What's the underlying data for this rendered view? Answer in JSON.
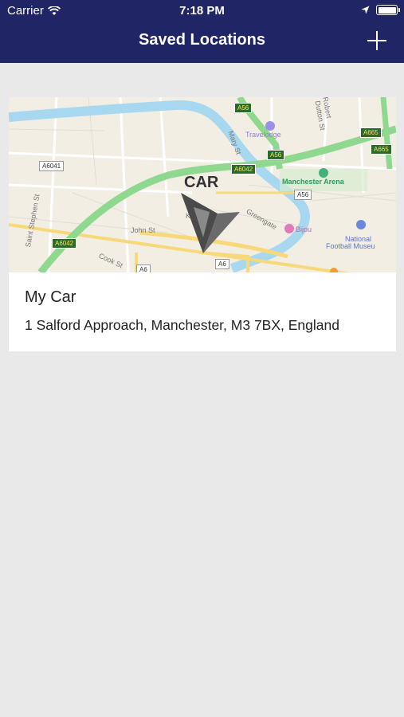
{
  "status": {
    "carrier": "Carrier",
    "time": "7:18 PM"
  },
  "nav": {
    "title": "Saved Locations",
    "add_icon": "plus-icon"
  },
  "location": {
    "name": "My Car",
    "address": "1 Salford Approach, Manchester, M3 7BX, England",
    "marker_label": "CAR",
    "map_labels": {
      "travelodge": "Travelodge",
      "manchester_arena": "Manchester Arena",
      "bijou": "Bijou",
      "national_football_museum_1": "National",
      "national_football_museum_2": "Football Museu",
      "john_st": "John St",
      "mary_st": "Mary St",
      "saint_stephen_st": "Saint Stephen St",
      "cook_st": "Cook St",
      "kings": "Ku",
      "dutton_st": "Dutton St",
      "robert_st": "Robert",
      "greengate": "Greengate"
    },
    "road_badges": {
      "a56_top": "A56",
      "a56_mid": "A56",
      "a56_low": "A56",
      "a665_1": "A665",
      "a665_2": "A665",
      "a6041": "A6041",
      "a6042_top": "A6042",
      "a6042_left": "A6042",
      "a6": "A6"
    }
  },
  "colors": {
    "header": "#202566",
    "background": "#e9e9e9",
    "road_major": "#8fd88f",
    "river": "#a8d8f0"
  }
}
